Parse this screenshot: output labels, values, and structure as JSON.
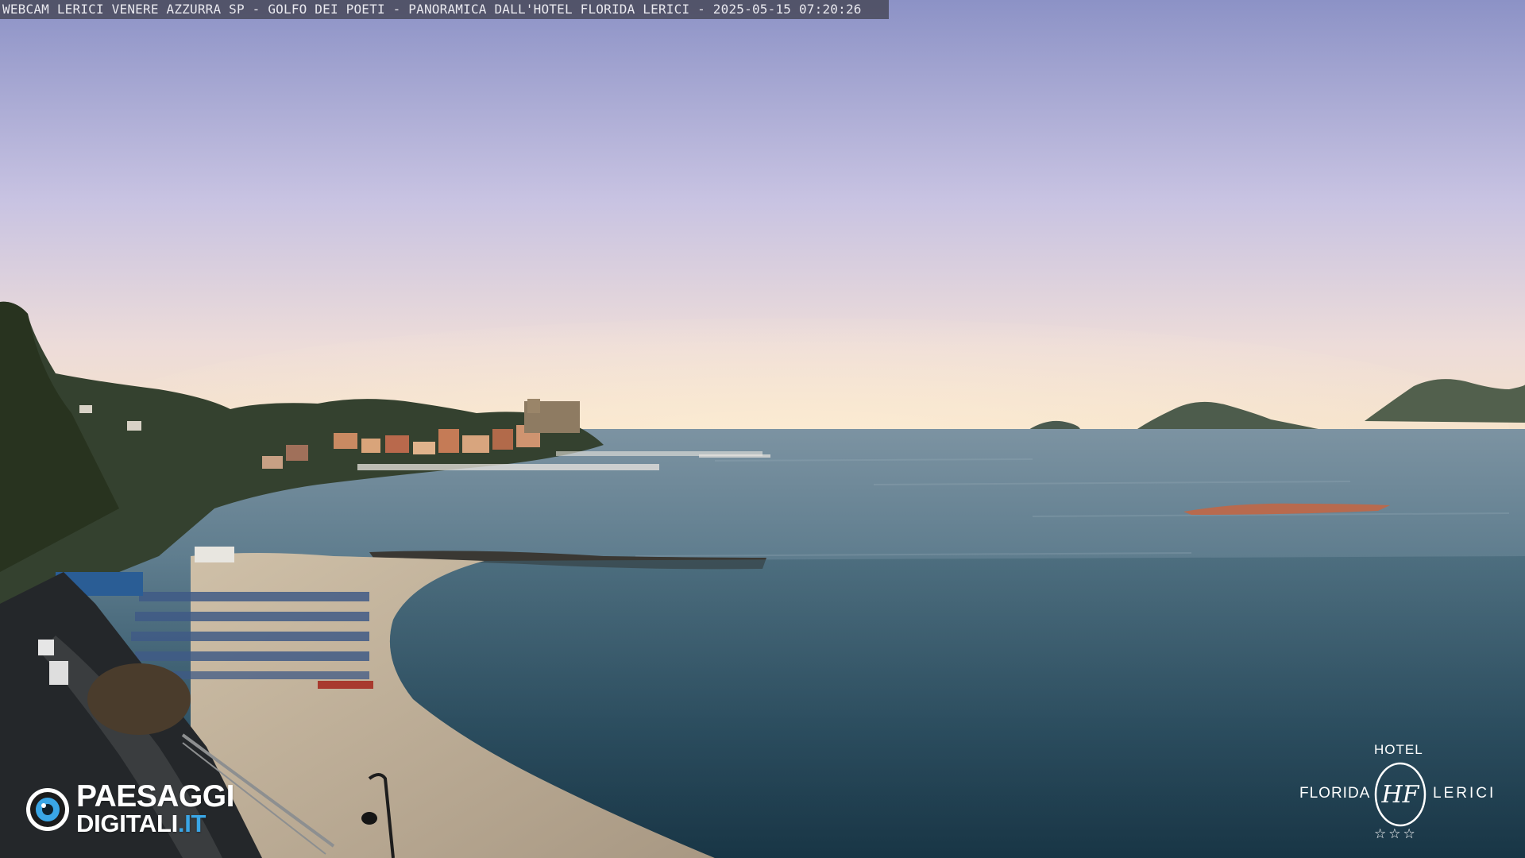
{
  "overlay": {
    "caption": "WEBCAM LERICI VENERE AZZURRA SP - GOLFO DEI POETI - PANORAMICA DALL'HOTEL FLORIDA LERICI - 2025-05-15 07:20:26"
  },
  "brand_left": {
    "line1": "PAESAGGI",
    "line2_main": "DIGITALI",
    "line2_tld": ".IT",
    "icon": "eye-logo-icon"
  },
  "brand_right": {
    "top": "HOTEL",
    "left": "FLORIDA",
    "right": "LERICI",
    "monogram": "HF",
    "stars": "☆☆☆",
    "icon": "hotel-monogram-icon"
  },
  "colors": {
    "sky_top": "#8f96c8",
    "sky_mid": "#cfc9e4",
    "horizon": "#f3e3cf",
    "sea_far": "#6f8798",
    "sea_near": "#1f3f52",
    "beach": "#c7b8a2",
    "accent_blue": "#3aa6e6"
  }
}
